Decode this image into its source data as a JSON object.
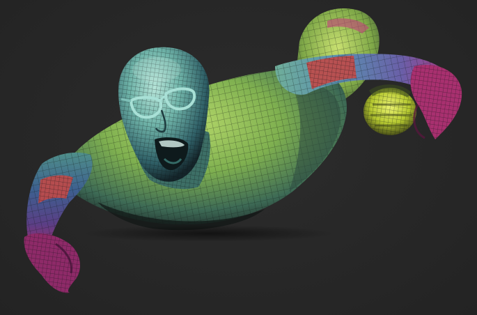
{
  "scene": {
    "subject": "sculpt-model",
    "background_color": "#282828",
    "polygroup_colors": {
      "head": "#5fa8a0",
      "torso": "#8fbf5a",
      "torso_dark": "#3f6f5a",
      "arm_band": "#c8504a",
      "hand": "#b0327a",
      "forearm": "#4a6fa0",
      "legs": "#a8c850",
      "shoe": "#c8d838",
      "glasses": "#9fd8d0"
    },
    "icons": {
      "wireframe": "mesh-wireframe-icon"
    }
  }
}
